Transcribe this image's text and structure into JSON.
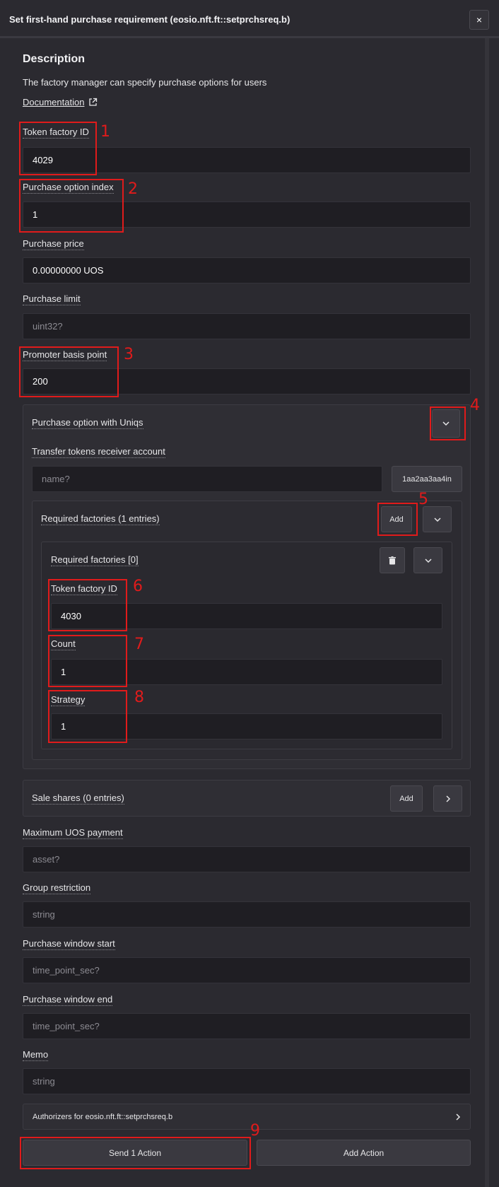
{
  "dialog": {
    "title": "Set first-hand purchase requirement (eosio.nft.ft::setprchsreq.b)",
    "close_icon": "close-icon",
    "close_glyph": "×"
  },
  "description": {
    "heading": "Description",
    "text": "The factory manager can specify purchase options for users",
    "doc_link": "Documentation"
  },
  "fields": {
    "token_factory_id": {
      "label": "Token factory ID",
      "value": "4029"
    },
    "purchase_option_index": {
      "label": "Purchase option index",
      "value": "1"
    },
    "purchase_price": {
      "label": "Purchase price",
      "value": "0.00000000 UOS"
    },
    "purchase_limit": {
      "label": "Purchase limit",
      "placeholder": "uint32?"
    },
    "promoter_basis_point": {
      "label": "Promoter basis point",
      "value": "200"
    },
    "maximum_uos_payment": {
      "label": "Maximum UOS payment",
      "placeholder": "asset?"
    },
    "group_restriction": {
      "label": "Group restriction",
      "placeholder": "string"
    },
    "purchase_window_start": {
      "label": "Purchase window start",
      "placeholder": "time_point_sec?"
    },
    "purchase_window_end": {
      "label": "Purchase window end",
      "placeholder": "time_point_sec?"
    },
    "memo": {
      "label": "Memo",
      "placeholder": "string"
    }
  },
  "uniqs_option": {
    "label": "Purchase option with Uniqs",
    "receiver": {
      "label": "Transfer tokens receiver account",
      "placeholder": "name?",
      "suggest_button": "1aa2aa3aa4in"
    },
    "required_factories": {
      "label": "Required factories (1 entries)",
      "add_label": "Add",
      "entry": {
        "label": "Required factories [0]",
        "token_factory_id": {
          "label": "Token factory ID",
          "value": "4030"
        },
        "count": {
          "label": "Count",
          "value": "1"
        },
        "strategy": {
          "label": "Strategy",
          "value": "1"
        }
      }
    }
  },
  "sale_shares": {
    "label": "Sale shares (0 entries)",
    "add_label": "Add"
  },
  "authorizers": {
    "label": "Authorizers for eosio.nft.ft::setprchsreq.b"
  },
  "actions": {
    "send": "Send 1 Action",
    "add": "Add Action"
  },
  "annotations": [
    "1",
    "2",
    "3",
    "4",
    "5",
    "6",
    "7",
    "8",
    "9"
  ],
  "colors": {
    "accent_red": "#e01b1b",
    "background": "#2b2a30",
    "input_bg": "#1f1e23"
  }
}
